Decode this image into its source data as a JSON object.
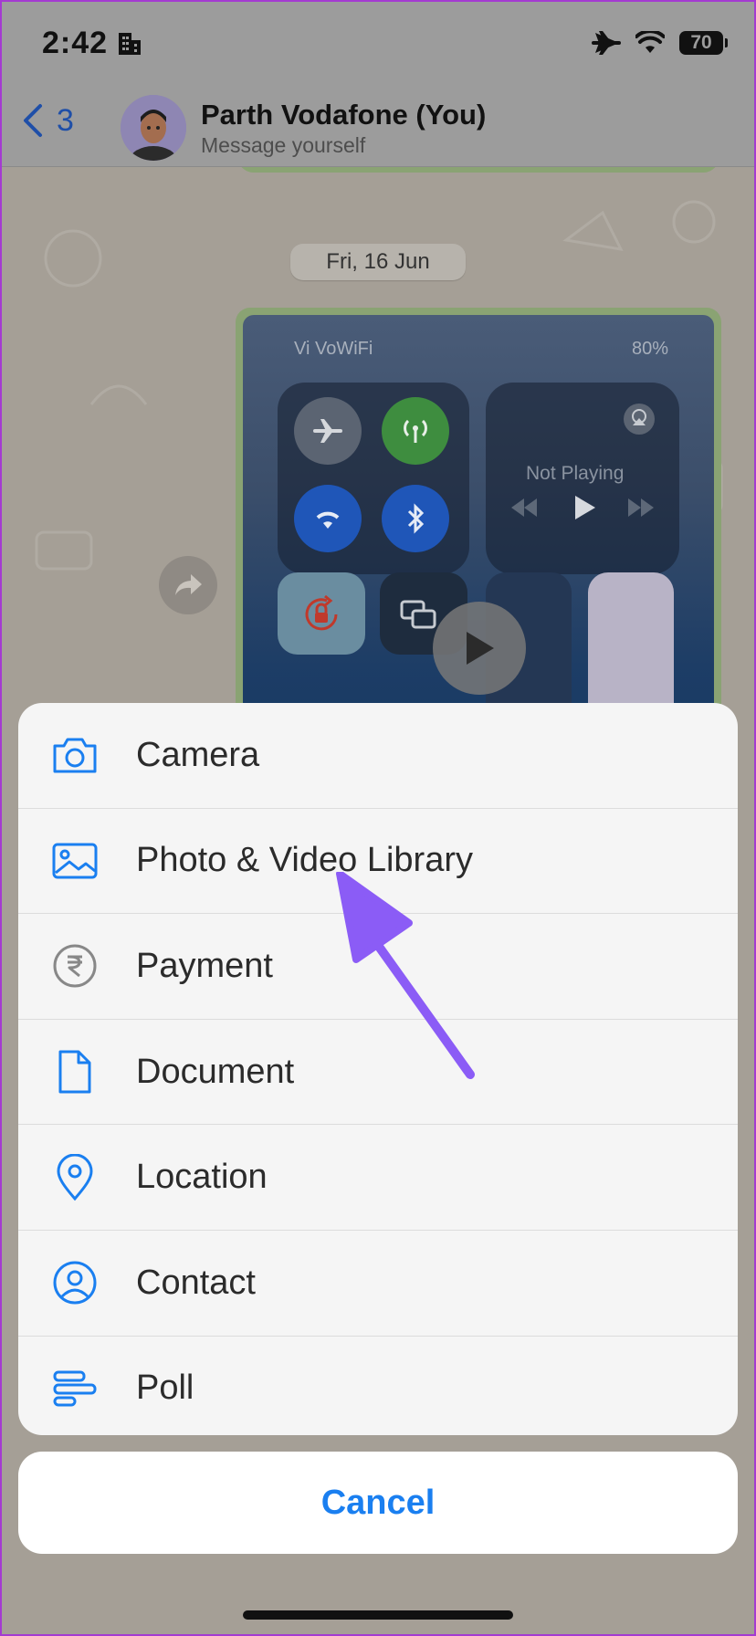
{
  "status_bar": {
    "time": "2:42",
    "battery": "70"
  },
  "header": {
    "back_count": "3",
    "title": "Parth Vodafone (You)",
    "subtitle": "Message yourself"
  },
  "chat": {
    "date_label": "Fri, 16 Jun",
    "screenshot": {
      "carrier": "Vi VoWiFi",
      "battery": "80%",
      "now_playing": "Not Playing"
    }
  },
  "sheet": {
    "items": [
      {
        "label": "Camera",
        "icon": "camera-icon"
      },
      {
        "label": "Photo & Video Library",
        "icon": "photo-icon"
      },
      {
        "label": "Payment",
        "icon": "rupee-icon"
      },
      {
        "label": "Document",
        "icon": "document-icon"
      },
      {
        "label": "Location",
        "icon": "location-pin-icon"
      },
      {
        "label": "Contact",
        "icon": "contact-icon"
      },
      {
        "label": "Poll",
        "icon": "poll-icon"
      }
    ],
    "cancel_label": "Cancel"
  },
  "colors": {
    "accent": "#1a7ff0",
    "annotation_arrow": "#8b5cf6"
  }
}
